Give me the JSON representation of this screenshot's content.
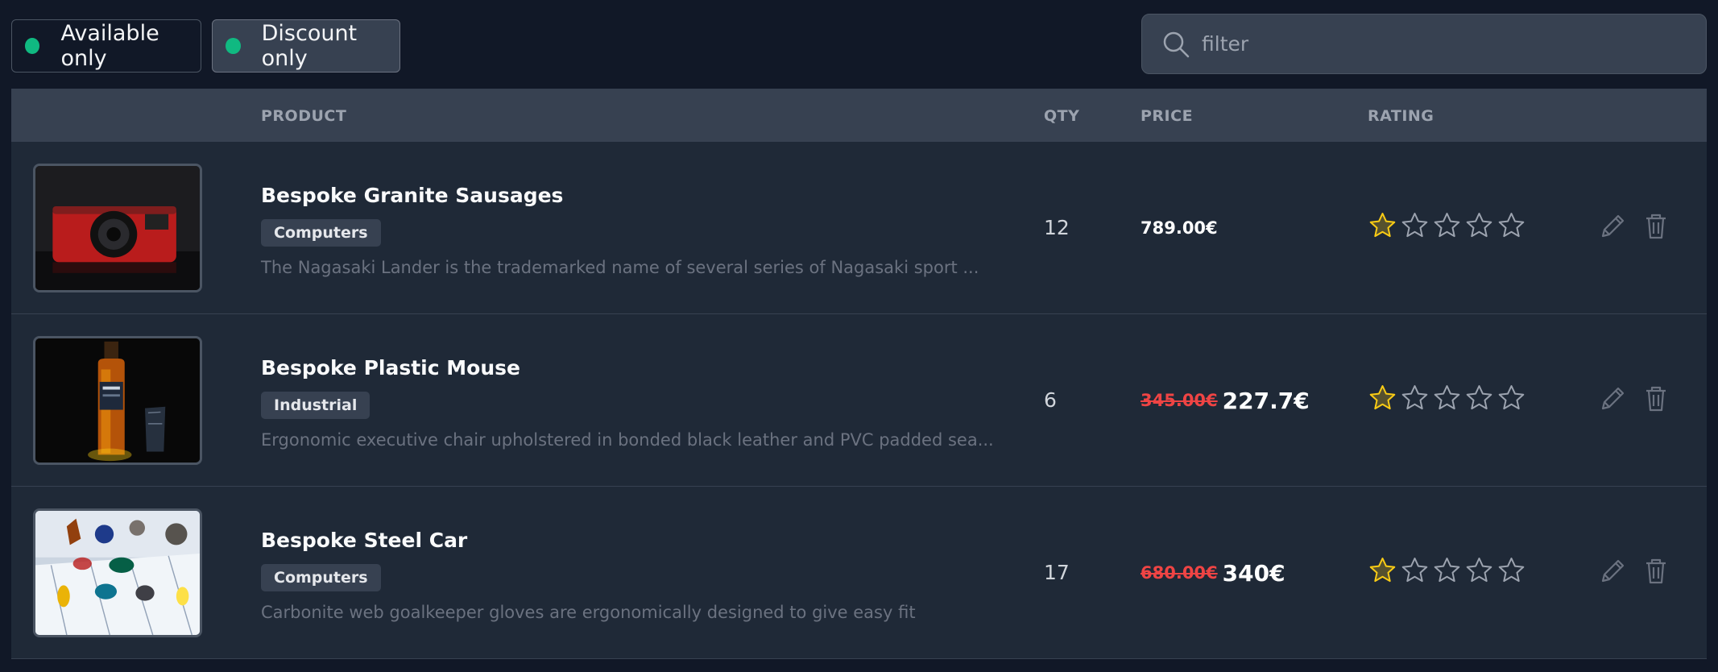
{
  "filters": {
    "available_label": "Available only",
    "discount_label": "Discount only",
    "accent_color": "#10b981"
  },
  "search": {
    "placeholder": "filter",
    "value": ""
  },
  "table": {
    "columns": [
      "",
      "PRODUCT",
      "QTY",
      "PRICE",
      "RATING"
    ],
    "rows": [
      {
        "image": "red-camera-photo",
        "name": "Bespoke Granite Sausages",
        "category": "Computers",
        "description": "The Nagasaki Lander is the trademarked name of several series of Nagasaki sport ...",
        "qty": "12",
        "old_price": "",
        "price": "789.00€",
        "rating": 1,
        "max_rating": 5
      },
      {
        "image": "whisky-bottle-photo",
        "name": "Bespoke Plastic Mouse",
        "category": "Industrial",
        "description": "Ergonomic executive chair upholstered in bonded black leather and PVC padded sea...",
        "qty": "6",
        "old_price": "345.00€",
        "price": "227.7€",
        "rating": 1,
        "max_rating": 5
      },
      {
        "image": "mineral-display-photo",
        "name": "Bespoke Steel Car",
        "category": "Computers",
        "description": "Carbonite web goalkeeper gloves are ergonomically designed to give easy fit",
        "qty": "17",
        "old_price": "680.00€",
        "price": "340€",
        "rating": 1,
        "max_rating": 5
      }
    ]
  },
  "colors": {
    "star_filled": "#facc15",
    "star_empty": "#9ca3af",
    "old_price": "#ef4444"
  }
}
